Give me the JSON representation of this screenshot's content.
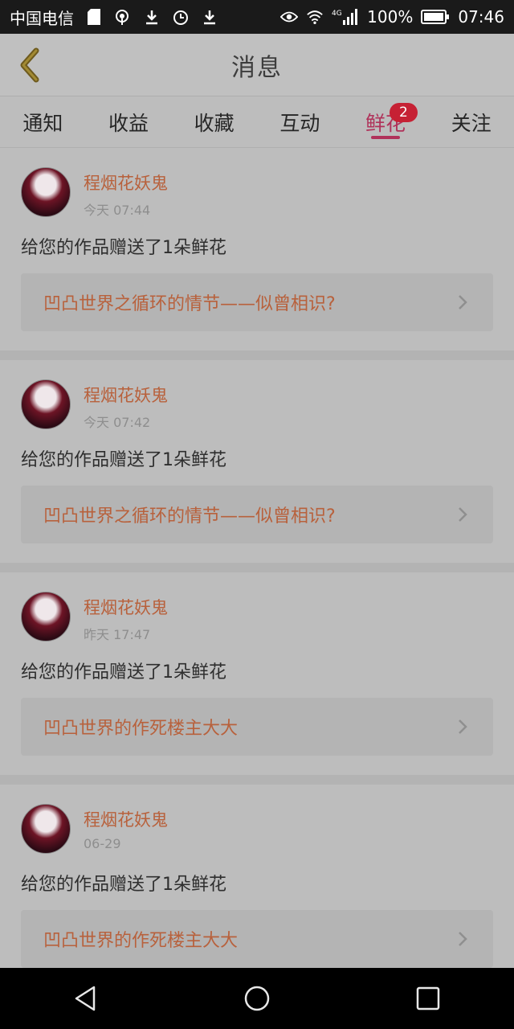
{
  "status_bar": {
    "carrier": "中国电信",
    "battery": "100%",
    "time": "07:46",
    "network": "4G"
  },
  "header": {
    "title": "消息"
  },
  "tabs": [
    {
      "label": "通知"
    },
    {
      "label": "收益"
    },
    {
      "label": "收藏"
    },
    {
      "label": "互动"
    },
    {
      "label": "鲜花",
      "badge": "2",
      "active": true
    },
    {
      "label": "关注"
    }
  ],
  "items": [
    {
      "username": "程烟花妖鬼",
      "time": "今天 07:44",
      "message": "给您的作品赠送了1朵鲜花",
      "work": "凹凸世界之循环的情节——似曾相识?"
    },
    {
      "username": "程烟花妖鬼",
      "time": "今天 07:42",
      "message": "给您的作品赠送了1朵鲜花",
      "work": "凹凸世界之循环的情节——似曾相识?"
    },
    {
      "username": "程烟花妖鬼",
      "time": "昨天 17:47",
      "message": "给您的作品赠送了1朵鲜花",
      "work": "凹凸世界的作死楼主大大"
    },
    {
      "username": "程烟花妖鬼",
      "time": "06-29",
      "message": "给您的作品赠送了1朵鲜花",
      "work": "凹凸世界的作死楼主大大"
    }
  ],
  "colors": {
    "accent": "#b0325a",
    "link": "#b8613c",
    "badge": "#c62134"
  }
}
